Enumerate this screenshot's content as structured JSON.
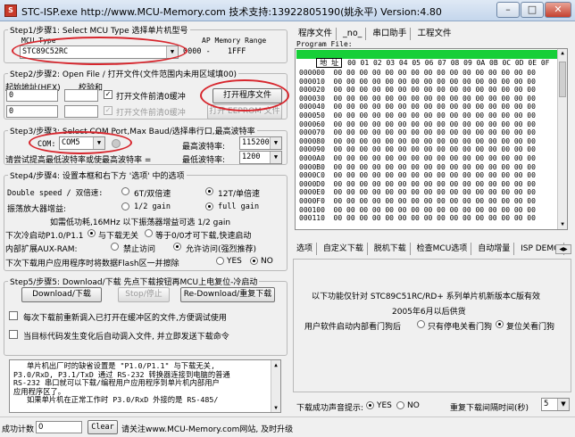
{
  "window": {
    "app_name": "STC-ISP.exe",
    "title": "http://www.MCU-Memory.com 技术支持:13922805190(姚永平) Version:4.80",
    "controls": [
      "–",
      "□",
      "✕"
    ]
  },
  "step1": {
    "legend": "Step1/步骤1: Select MCU Type  选择单片机型号",
    "mcu_type_label": "MCU Type",
    "ap_memory_label": "AP Memory Range",
    "mcu_type_value": "STC89C52RC",
    "ap_range_start": "0000",
    "ap_range_sep": "-",
    "ap_range_end": "1FFF"
  },
  "step2": {
    "legend": "Step2/步骤2: Open File / 打开文件(文件范围内未用区域填00)",
    "start_address_label": "起始地址(HEX)",
    "checksum_label": "校验和",
    "address1": "0",
    "address2": "0",
    "checkbox1_label": "打开文件前清0缓冲",
    "checkbox1_checked": "✓",
    "checkbox2_label": "打开文件前清0缓冲",
    "checkbox2_checked": "✓",
    "open_program_button": "打开程序文件",
    "open_eeprom_button": "打开 EEPROM 文件"
  },
  "step3": {
    "legend": "Step3/步骤3: Select COM Port,Max Baud/选择串行口,最高波特率",
    "com_label": "COM:",
    "com_value": "COM5",
    "max_baud_label": "最高波特率:",
    "max_baud_value": "115200",
    "hint_text": "请尝试提高最低波特率或使最高波特率 =",
    "min_baud_label": "最低波特率:",
    "min_baud_value": "1200"
  },
  "step4": {
    "legend": "Step4/步骤4: 设置本框和右下方 '选项' 中的选项",
    "double_speed_label": "Double speed / 双倍速:",
    "speed_6t": "6T/双倍速",
    "speed_12t": "12T/单倍速",
    "amp_gain_label": "振荡放大器增益:",
    "gain_half": "1/2 gain",
    "gain_full": "full gain",
    "gain_note": "如需低功耗,16MHz 以下振荡器增益可选 1/2 gain",
    "p1_label": "下次冷启动P1.0/P1.1",
    "p1_opt1": "与下载无关",
    "p1_opt2": "等于0/0才可下载,快速启动",
    "auxram_label": "内部扩展AUX-RAM:",
    "auxram_opt1": "禁止访问",
    "auxram_opt2": "允许访问(强烈推荐)",
    "flash_label": "下次下载用户应用程序时将数据Flash区一并擦除",
    "flash_yes": "YES",
    "flash_no": "NO"
  },
  "step5": {
    "legend": "Step5/步骤5: Download/下载  先点下载按钮再MCU上电复位-冷启动",
    "download_button": "Download/下载",
    "stop_button": "Stop/停止",
    "redownload_button": "Re-Download/重复下载",
    "option1": "每次下载前重新调入已打开在缓冲区的文件,方便调试使用",
    "option2": "当目标代码发生变化后自动调入文件, 并立即发送下载命令"
  },
  "note_text": [
    "   单片机出厂时的缺省设置是 \"P1.0/P1.1\" 与下载无关,",
    "P3.0/RxD, P3.1/TxD 通过 RS-232 转换器连接到电脑的普通",
    "RS-232 串口就可以下载/编程用户应用程序到单片机内部用户",
    "应用程序区了。",
    "   如果单片机在正常工作时 P3.0/RxD 外接的是 RS-485/"
  ],
  "status": {
    "success_count_label": "成功计数",
    "success_count_value": "0",
    "clear_button": "Clear",
    "link_text": "请关注www.MCU-Memory.com网站, 及时升级"
  },
  "right_tabs": [
    "程序文件",
    "_no_",
    "串口助手",
    "工程文件"
  ],
  "program_file_label": "Program File:",
  "hex": {
    "header_addr": "地 址",
    "header_cols": "00 01 02 03 04 05 06 07 08 09 0A 0B 0C 0D 0E 0F",
    "rows": [
      {
        "addr": "000000",
        "bytes": "00 00 00 00 00 00 00 00 00 00 00 00 00 00 00 00"
      },
      {
        "addr": "000010",
        "bytes": "00 00 00 00 00 00 00 00 00 00 00 00 00 00 00 00"
      },
      {
        "addr": "000020",
        "bytes": "00 00 00 00 00 00 00 00 00 00 00 00 00 00 00 00"
      },
      {
        "addr": "000030",
        "bytes": "00 00 00 00 00 00 00 00 00 00 00 00 00 00 00 00"
      },
      {
        "addr": "000040",
        "bytes": "00 00 00 00 00 00 00 00 00 00 00 00 00 00 00 00"
      },
      {
        "addr": "000050",
        "bytes": "00 00 00 00 00 00 00 00 00 00 00 00 00 00 00 00"
      },
      {
        "addr": "000060",
        "bytes": "00 00 00 00 00 00 00 00 00 00 00 00 00 00 00 00"
      },
      {
        "addr": "000070",
        "bytes": "00 00 00 00 00 00 00 00 00 00 00 00 00 00 00 00"
      },
      {
        "addr": "000080",
        "bytes": "00 00 00 00 00 00 00 00 00 00 00 00 00 00 00 00"
      },
      {
        "addr": "000090",
        "bytes": "00 00 00 00 00 00 00 00 00 00 00 00 00 00 00 00"
      },
      {
        "addr": "0000A0",
        "bytes": "00 00 00 00 00 00 00 00 00 00 00 00 00 00 00 00"
      },
      {
        "addr": "0000B0",
        "bytes": "00 00 00 00 00 00 00 00 00 00 00 00 00 00 00 00"
      },
      {
        "addr": "0000C0",
        "bytes": "00 00 00 00 00 00 00 00 00 00 00 00 00 00 00 00"
      },
      {
        "addr": "0000D0",
        "bytes": "00 00 00 00 00 00 00 00 00 00 00 00 00 00 00 00"
      },
      {
        "addr": "0000E0",
        "bytes": "00 00 00 00 00 00 00 00 00 00 00 00 00 00 00 00"
      },
      {
        "addr": "0000F0",
        "bytes": "00 00 00 00 00 00 00 00 00 00 00 00 00 00 00 00"
      },
      {
        "addr": "000100",
        "bytes": "00 00 00 00 00 00 00 00 00 00 00 00 00 00 00 00"
      },
      {
        "addr": "000110",
        "bytes": "00 00 00 00 00 00 00 00 00 00 00 00 00 00 00 00"
      }
    ]
  },
  "option_tabs": [
    "选项",
    "自定义下载",
    "脱机下载",
    "检查MCU选项",
    "自动增量",
    "ISP DEMO"
  ],
  "info": {
    "line1": "以下功能仅针对 STC89C51RC/RD+ 系列单片机新版本C版有效",
    "line2": "2005年6月以后供货",
    "reset_label": "用户软件启动内部看门狗后",
    "reset_opt1": "只有停电关看门狗",
    "reset_opt2": "复位关看门狗"
  },
  "bottom_right": {
    "sound_label": "下载成功声音提示:",
    "sound_yes": "YES",
    "sound_no": "NO",
    "repeat_label": "重复下载间隔时间(秒)",
    "repeat_value": "5"
  },
  "colors": {
    "annotation_red": "#d7262d",
    "hex_header_green": "#17cf38"
  }
}
